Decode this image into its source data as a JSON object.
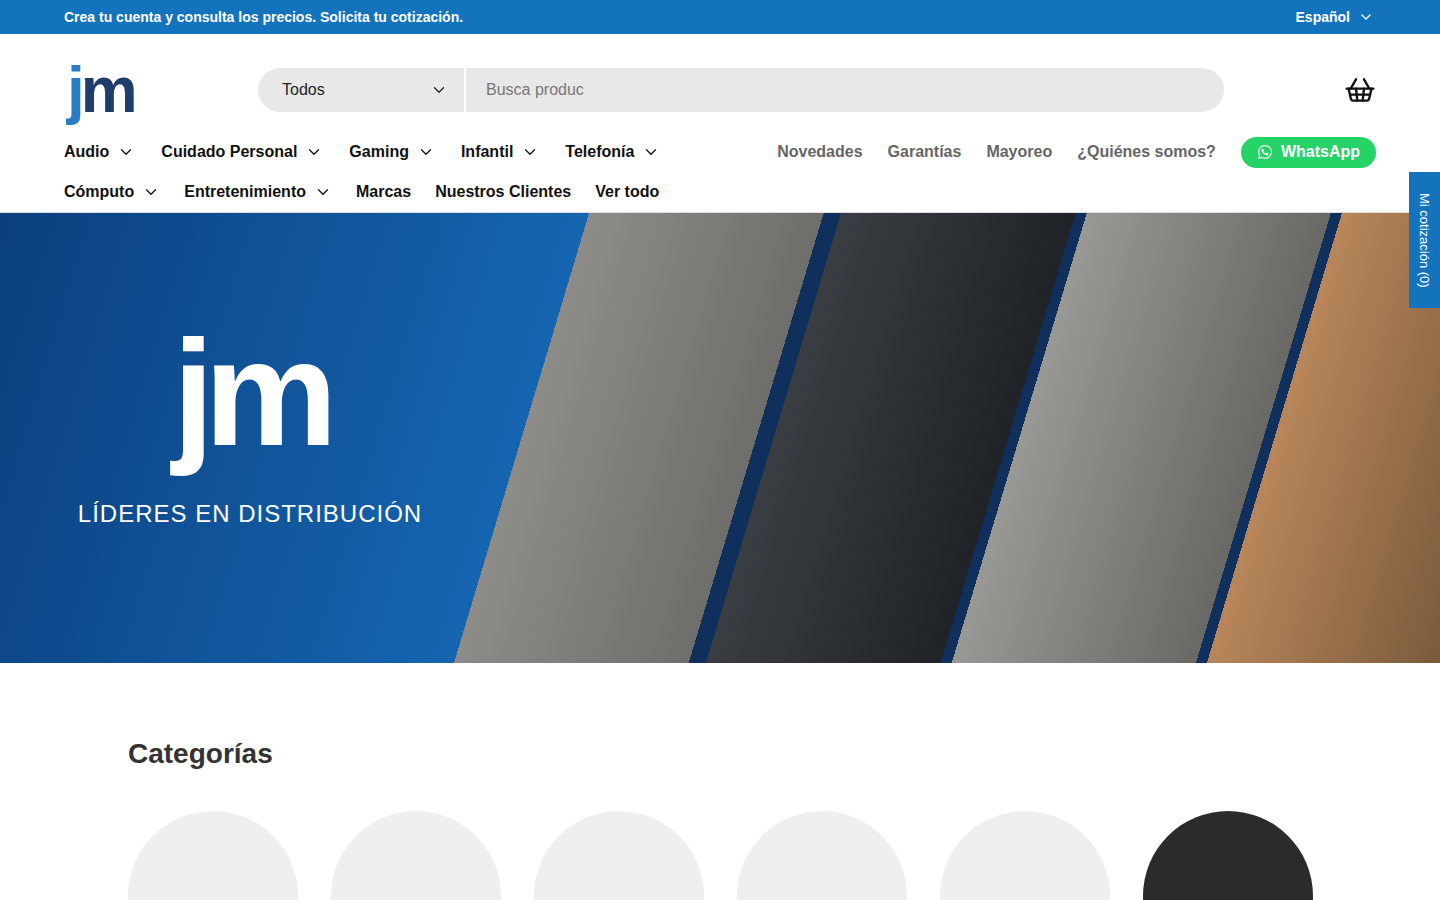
{
  "announcement": {
    "text": "Crea tu cuenta y consulta los precios. Solicita tu cotización.",
    "language": "Español"
  },
  "logo": [
    {
      "text": "j",
      "color": "#2b7bc4"
    },
    {
      "text": "m",
      "color": "#1f3d6b"
    }
  ],
  "search": {
    "category": "Todos",
    "placeholder": "Busca produc"
  },
  "nav": {
    "rows": [
      [
        {
          "label": "Audio",
          "dropdown": true
        },
        {
          "label": "Cuidado Personal",
          "dropdown": true
        },
        {
          "label": "Gaming",
          "dropdown": true
        },
        {
          "label": "Infantil",
          "dropdown": true
        },
        {
          "label": "Telefonía",
          "dropdown": true
        }
      ],
      [
        {
          "label": "Cómputo",
          "dropdown": true
        },
        {
          "label": "Entretenimiento",
          "dropdown": true
        },
        {
          "label": "Marcas",
          "dropdown": false
        },
        {
          "label": "Nuestros Clientes",
          "dropdown": false
        },
        {
          "label": "Ver todo",
          "dropdown": false
        }
      ]
    ],
    "links": [
      "Novedades",
      "Garantías",
      "Mayoreo",
      "¿Quiénes somos?"
    ],
    "whatsapp": "WhatsApp"
  },
  "quote_tab": "Mi cotización (0)",
  "hero": {
    "tagline": "LÍDERES EN DISTRIBUCIÓN"
  },
  "categories": {
    "title": "Categorías",
    "items": [
      {
        "color": "#efefef"
      },
      {
        "color": "#efefef"
      },
      {
        "color": "#efefef"
      },
      {
        "color": "#efefef"
      },
      {
        "color": "#efefef"
      },
      {
        "color": "#2b2b2b"
      }
    ]
  }
}
